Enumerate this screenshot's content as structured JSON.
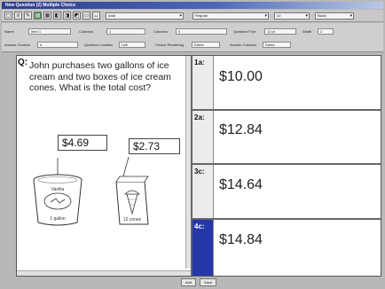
{
  "window": {
    "title": "New Question (2) Multiple Choice"
  },
  "toolbar": {
    "buttons": [
      "▢",
      "≡",
      "✎",
      "▤",
      "▦",
      "◧",
      "◨",
      "◩",
      "▭",
      "↔"
    ],
    "font": "Arial",
    "style": "Regular",
    "size": "10",
    "color": "Black"
  },
  "properties": {
    "row1": [
      {
        "label": "Name",
        "value": "Item 1"
      },
      {
        "label": "Columns",
        "value": "1"
      },
      {
        "label": "Columns",
        "value": "0"
      },
      {
        "label": "Question Font",
        "value": "12 pt"
      },
      {
        "label": "Width",
        "value": "2"
      }
    ],
    "row2": [
      {
        "label": "Answer Choices",
        "value": "4"
      },
      {
        "label": "Question Location",
        "value": "Left"
      },
      {
        "label": "Choice Rendering",
        "value": "Direct"
      },
      {
        "label": "Answer Columns",
        "value": "Direct"
      }
    ]
  },
  "question": {
    "tag": "Q:",
    "text": "John purchases two gallons of ice cream and two boxes of ice cream cones. What is the total cost?",
    "price_gallon": "$4.69",
    "price_cones": "$2.73",
    "tub_brand": "Vanilla",
    "tub_label": "1 gallon",
    "cones_label": "12 cones"
  },
  "answers": [
    {
      "tag": "1a:",
      "value": "$10.00",
      "selected": false
    },
    {
      "tag": "2a:",
      "value": "$12.84",
      "selected": false
    },
    {
      "tag": "3c:",
      "value": "$14.64",
      "selected": false
    },
    {
      "tag": "4c:",
      "value": "$14.84",
      "selected": true
    }
  ],
  "footer": {
    "left_button": "Add",
    "right_button": "Save"
  },
  "colors": {
    "selected": "#2438a8",
    "title_gradient_start": "#2c3d8e"
  }
}
